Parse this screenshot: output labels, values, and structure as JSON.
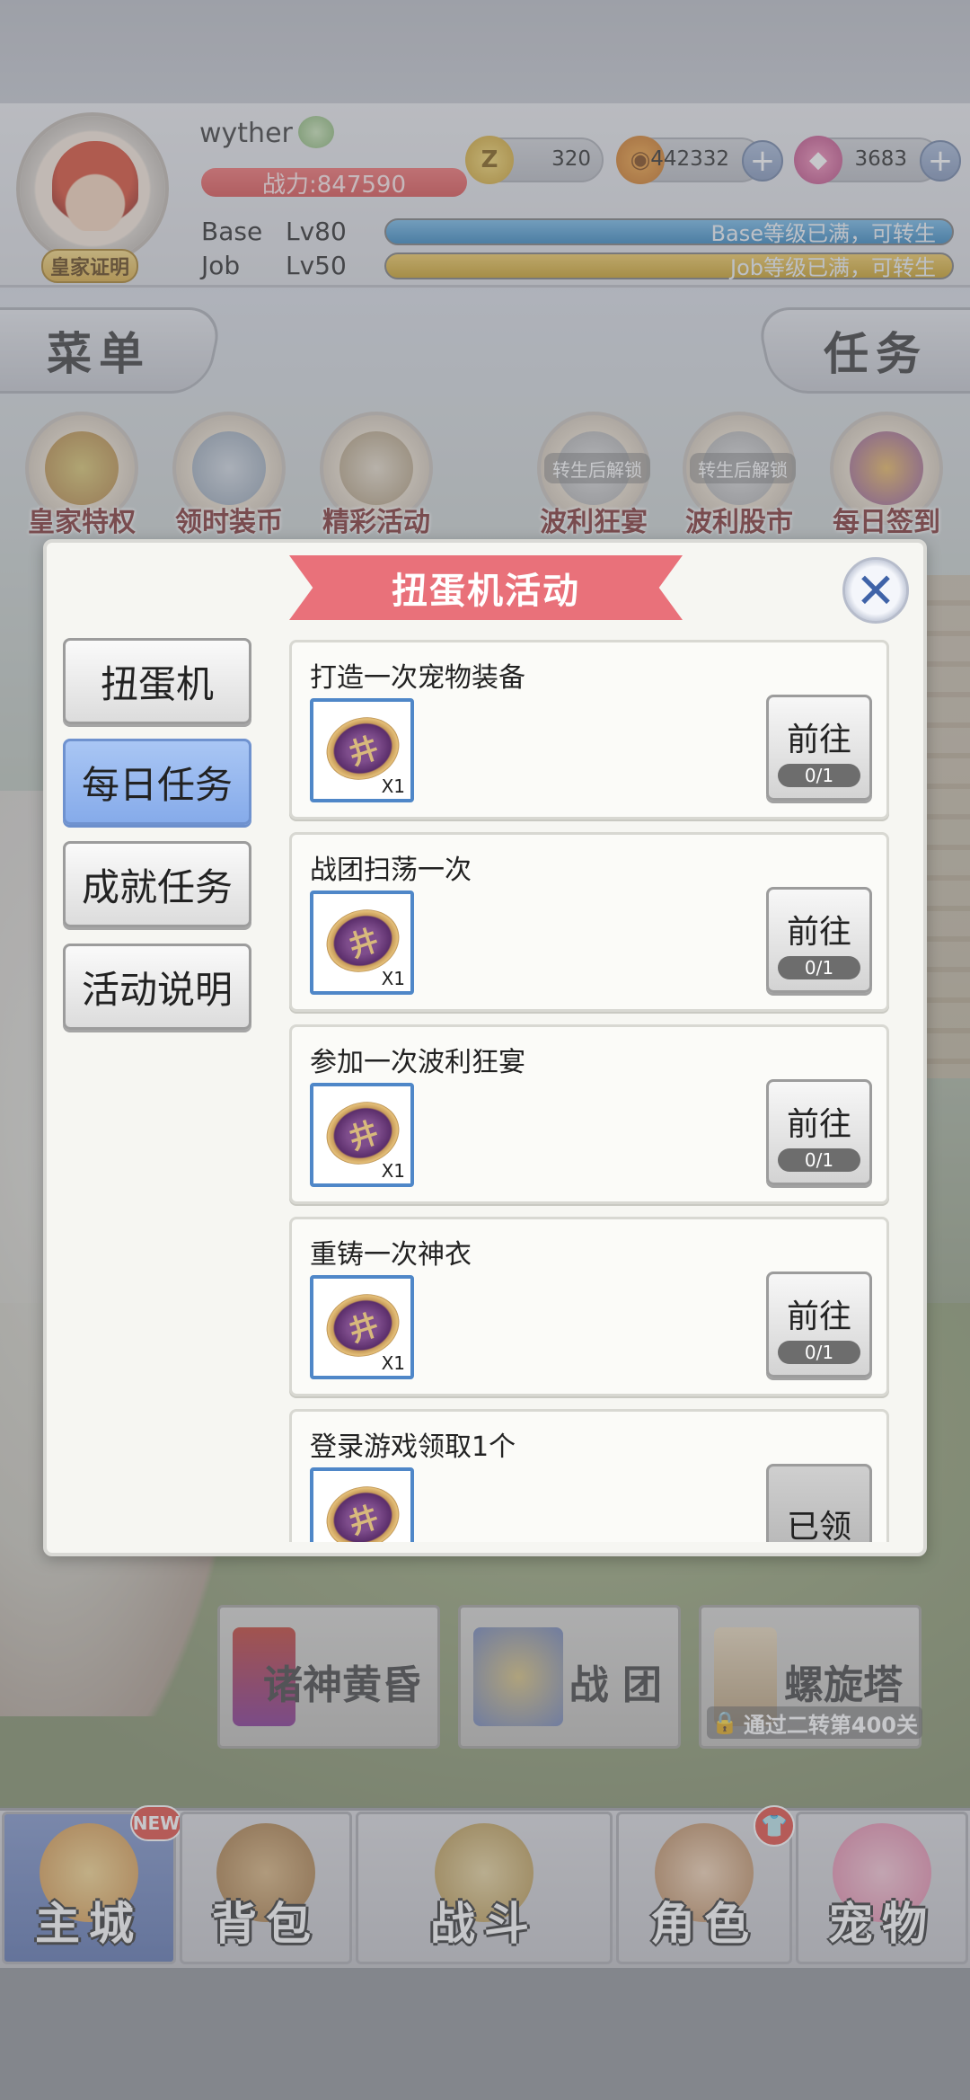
{
  "player": {
    "name": "wyther",
    "power": "战力:847590",
    "badge": "皇家证明",
    "base_label": "Base",
    "base_level": "Lv80",
    "base_status": "Base等级已满，可转生",
    "job_label": "Job",
    "job_level": "Lv50",
    "job_status": "Job等级已满，可转生"
  },
  "currencies": [
    {
      "icon": "zeny-coin-icon",
      "value": "320"
    },
    {
      "icon": "gold-coin-icon",
      "value": "442332"
    },
    {
      "icon": "gem-icon",
      "value": "3683"
    }
  ],
  "side_tabs": {
    "menu": "菜单",
    "task": "任务"
  },
  "activities": [
    {
      "label": "皇家特权",
      "locked": ""
    },
    {
      "label": "领时装币",
      "locked": ""
    },
    {
      "label": "精彩活动",
      "locked": ""
    },
    {
      "label": "波利狂宴",
      "locked": "转生后解锁"
    },
    {
      "label": "波利股市",
      "locked": "转生后解锁"
    },
    {
      "label": "每日签到",
      "locked": ""
    }
  ],
  "popup": {
    "title": "扭蛋机活动",
    "tabs": [
      {
        "label": "扭蛋机",
        "active": false
      },
      {
        "label": "每日任务",
        "active": true
      },
      {
        "label": "成就任务",
        "active": false
      },
      {
        "label": "活动说明",
        "active": false
      }
    ],
    "tasks": [
      {
        "title": "打造一次宠物装备",
        "qty": "X1",
        "button": "前往",
        "progress": "0/1"
      },
      {
        "title": "战团扫荡一次",
        "qty": "X1",
        "button": "前往",
        "progress": "0/1"
      },
      {
        "title": "参加一次波利狂宴",
        "qty": "X1",
        "button": "前往",
        "progress": "0/1"
      },
      {
        "title": "重铸一次神衣",
        "qty": "X1",
        "button": "前往",
        "progress": "0/1"
      },
      {
        "title": "登录游戏领取1个",
        "qty": "",
        "button": "已领",
        "progress": ""
      }
    ]
  },
  "buildings": [
    {
      "label": "诸神黄昏",
      "lock": ""
    },
    {
      "label": "战 团",
      "lock": ""
    },
    {
      "label": "螺旋塔",
      "lock": "通过二转第400关"
    }
  ],
  "nav": [
    {
      "label": "主城",
      "badge": "NEW",
      "active": true
    },
    {
      "label": "背包",
      "badge": "",
      "active": false
    },
    {
      "label": "战斗",
      "badge": "",
      "active": false
    },
    {
      "label": "角色",
      "badge": "shirt",
      "active": false
    },
    {
      "label": "宠物",
      "badge": "",
      "active": false
    }
  ]
}
